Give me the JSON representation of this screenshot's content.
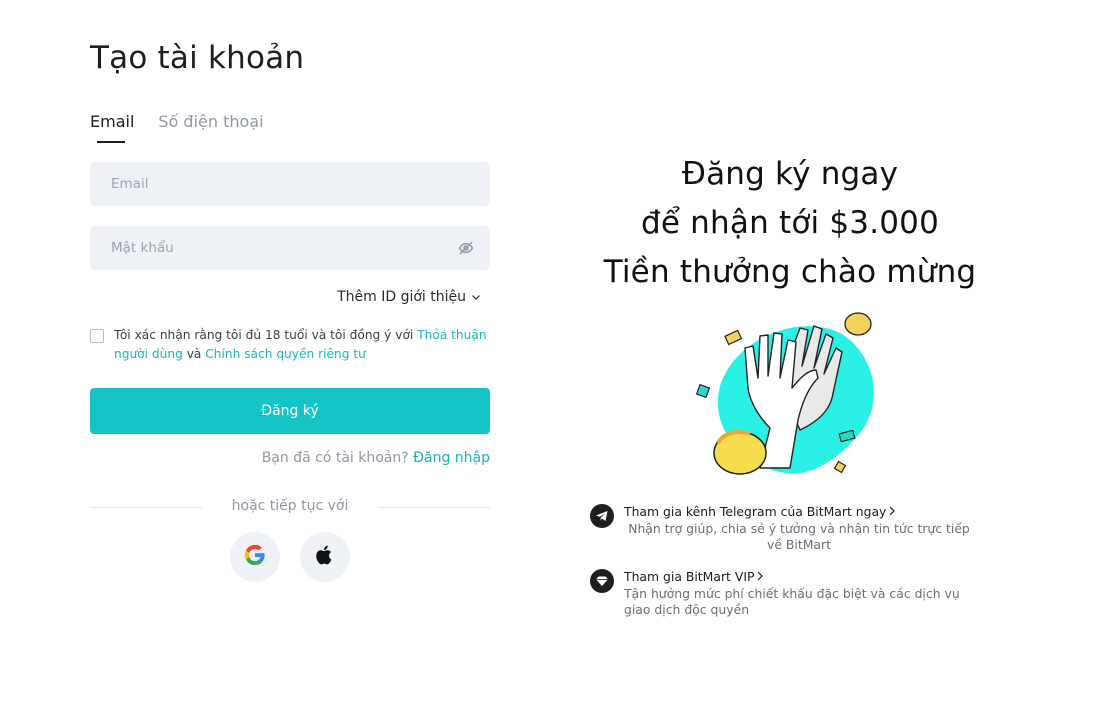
{
  "page": {
    "title": "Tạo tài khoản"
  },
  "tabs": [
    {
      "label": "Email"
    },
    {
      "label": "Số điện thoại"
    }
  ],
  "form": {
    "email_placeholder": "Email",
    "password_placeholder": "Mật khẩu",
    "referral_label": "Thêm ID giới thiệu",
    "agree_prefix": "Tôi xác nhận rằng tôi đủ 18 tuổi và tôi đồng ý với",
    "agree_link_terms": "Thỏa thuận người dùng",
    "agree_and": "và",
    "agree_link_privacy": "Chính sách quyền riêng tư",
    "register_label": "Đăng ký",
    "login_prompt": "Bạn đã có tài khoản?",
    "login_link": "Đăng nhập",
    "divider_text": "hoặc tiếp tục với"
  },
  "social": [
    {
      "name": "google",
      "icon": "google-icon"
    },
    {
      "name": "apple",
      "icon": "apple-icon"
    }
  ],
  "promo": {
    "line1": "Đăng ký ngay",
    "line2": "để nhận tới $3.000",
    "line3": "Tiền thưởng chào mừng"
  },
  "benefits": [
    {
      "icon": "telegram-icon",
      "title": "Tham gia kênh Telegram của BitMart ngay",
      "desc": "Nhận trợ giúp, chia sẻ ý tưởng và nhận tin tức trực tiếp về BitMart"
    },
    {
      "icon": "diamond-icon",
      "title": "Tham gia BitMart VIP",
      "desc": "Tận hưởng mức phí chiết khấu đặc biệt và các dịch vụ giao dịch độc quyền"
    }
  ],
  "colors": {
    "accent": "#17c4c5",
    "link": "#17b4b6",
    "field_bg": "#eef2f6",
    "muted_text": "#8f99a4"
  }
}
